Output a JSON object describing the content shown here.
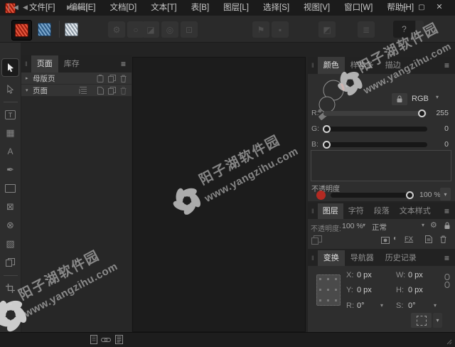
{
  "titlebar": {
    "menus": [
      {
        "label": "文件[F]"
      },
      {
        "label": "编辑[E]"
      },
      {
        "label": "文档[D]"
      },
      {
        "label": "文本[T]"
      },
      {
        "label": "表[B]"
      },
      {
        "label": "图层[L]"
      },
      {
        "label": "选择[S]"
      },
      {
        "label": "视图[V]"
      },
      {
        "label": "窗口[W]"
      },
      {
        "label": "帮助[H]"
      }
    ],
    "controls": {
      "minimize": "–",
      "maximize": "▢",
      "close": "✕"
    }
  },
  "toolbar": {
    "help": "?"
  },
  "icons": {
    "hamburger": "≡",
    "grip": "‖",
    "chevron_down": "▾",
    "chevron_right": "▸",
    "expand": "»",
    "gear": "⚙",
    "half_circle": "◐",
    "table": "▦",
    "image": "▧",
    "frame_x": "⊠",
    "ellipse_x": "⊗",
    "pen": "✒",
    "letter_a": "A",
    "letter_t": "T",
    "prev": "◀",
    "next": "▶",
    "first": "▏◀",
    "last": "▶▕",
    "disabled_1a": "⚙",
    "disabled_1b": "○",
    "disabled_2a": "◪",
    "disabled_2b": "◎",
    "disabled_2c": "⊡",
    "disabled_3a": "⚑",
    "disabled_3b": "▪",
    "disabled_4": "◩",
    "disabled_5": "≣"
  },
  "pages_panel": {
    "tabs": [
      {
        "label": "页面"
      },
      {
        "label": "库存"
      }
    ],
    "rows": [
      {
        "label": "母版页"
      },
      {
        "label": "页面"
      }
    ]
  },
  "color_panel": {
    "tabs": [
      {
        "label": "颜色"
      },
      {
        "label": "样本条"
      },
      {
        "label": "描边"
      }
    ],
    "color_model": "RGB",
    "sliders": [
      {
        "label": "R:",
        "value": "255"
      },
      {
        "label": "G:",
        "value": "0"
      },
      {
        "label": "B:",
        "value": "0"
      }
    ],
    "opacity": {
      "label": "不透明度",
      "value": "100 %"
    }
  },
  "layers_panel": {
    "tabs": [
      {
        "label": "图层"
      },
      {
        "label": "字符"
      },
      {
        "label": "段落"
      },
      {
        "label": "文本样式"
      }
    ],
    "opacity_label": "不透明度:",
    "opacity_value": "100 %",
    "blend_mode": "正常",
    "fx": "FX"
  },
  "transform_panel": {
    "tabs": [
      {
        "label": "变换"
      },
      {
        "label": "导航器"
      },
      {
        "label": "历史记录"
      }
    ],
    "fields": {
      "x": {
        "label": "X:",
        "value": "0 px"
      },
      "y": {
        "label": "Y:",
        "value": "0 px"
      },
      "w": {
        "label": "W:",
        "value": "0 px"
      },
      "h": {
        "label": "H:",
        "value": "0 px"
      },
      "r": {
        "label": "R:",
        "value": "0°"
      },
      "s": {
        "label": "S:",
        "value": "0°"
      }
    }
  },
  "watermark": {
    "line1": "阳子湖软件园",
    "line2": "www.yangzihu.com"
  },
  "colors": {
    "publisher_red": "#c23527",
    "designer_blue": "#4a7fae",
    "photo_gray": "#c9d2d8",
    "fill_red": "#b42a22",
    "panel_bg": "#2e2e2e",
    "canvas_bg": "#1c1c1c",
    "titlebar_bg": "#1b1b1b"
  }
}
